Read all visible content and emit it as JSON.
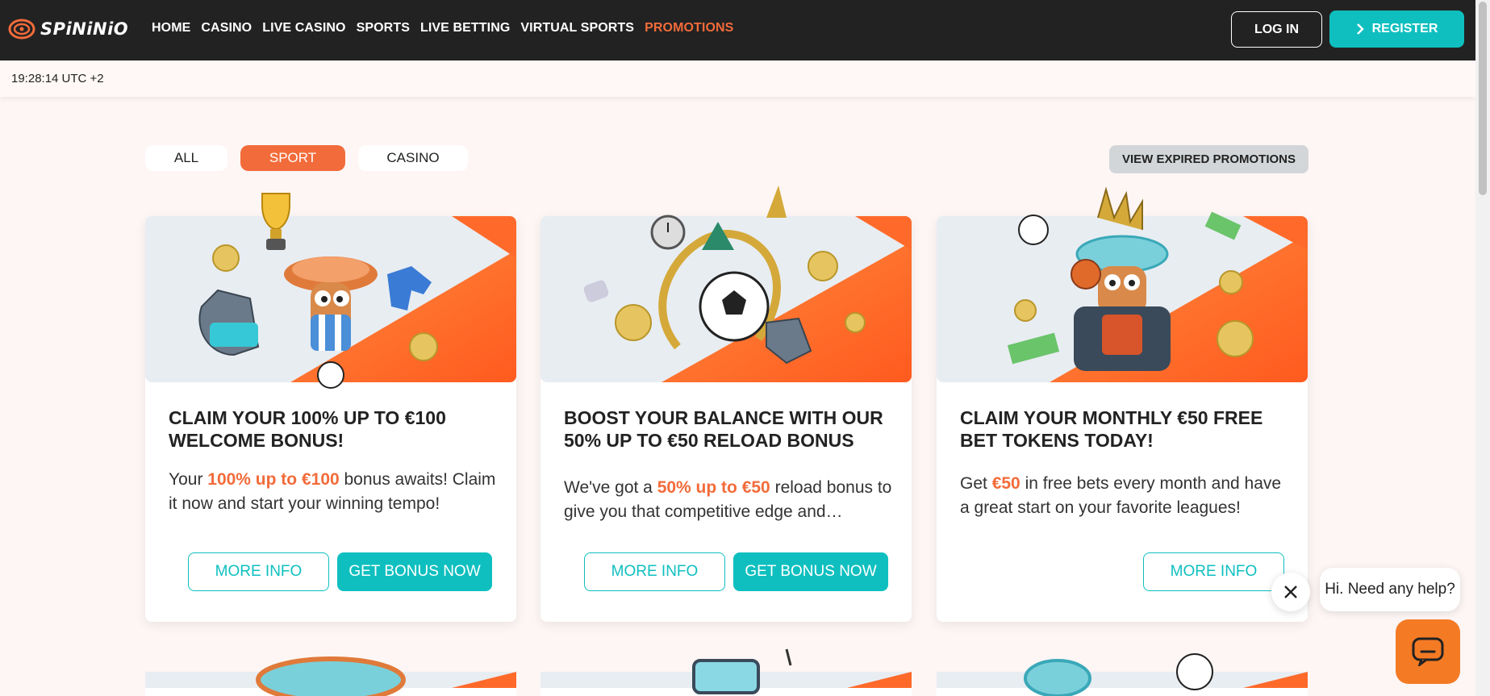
{
  "header": {
    "logo_text": "SPiNiNiO",
    "nav": [
      {
        "label": "HOME",
        "active": false
      },
      {
        "label": "CASINO",
        "active": false
      },
      {
        "label": "LIVE CASINO",
        "active": false
      },
      {
        "label": "SPORTS",
        "active": false
      },
      {
        "label": "LIVE BETTING",
        "active": false
      },
      {
        "label": "VIRTUAL SPORTS",
        "active": false
      },
      {
        "label": "PROMOTIONS",
        "active": true
      }
    ],
    "login_label": "LOG IN",
    "register_label": "REGISTER"
  },
  "timebar": {
    "time": "19:28:14 UTC +2"
  },
  "filters": {
    "tabs": [
      {
        "label": "ALL",
        "selected": false
      },
      {
        "label": "SPORT",
        "selected": true
      },
      {
        "label": "CASINO",
        "selected": false
      }
    ],
    "expired_label": "VIEW EXPIRED PROMOTIONS"
  },
  "promotions": [
    {
      "title": "CLAIM YOUR 100% UP TO €100 WELCOME BONUS!",
      "desc_before": "Your ",
      "desc_highlight": "100% up to €100",
      "desc_after": " bonus awaits! Claim it now and start your winning tempo!",
      "more_info_label": "MORE INFO",
      "bonus_label": "GET BONUS NOW"
    },
    {
      "title": "BOOST YOUR BALANCE WITH OUR 50% UP TO €50 RELOAD BONUS",
      "desc_before": "We've got a ",
      "desc_highlight": "50% up to €50",
      "desc_after": " reload bonus to give you that competitive edge and ensure…",
      "more_info_label": "MORE INFO",
      "bonus_label": "GET BONUS NOW"
    },
    {
      "title": "CLAIM YOUR MONTHLY €50 FREE BET TOKENS TODAY!",
      "desc_before": "Get ",
      "desc_highlight": "€50",
      "desc_after": " in free bets every month and have a great start on your favorite leagues!",
      "more_info_label": "MORE INFO"
    }
  ],
  "chat": {
    "greeting": "Hi. Need any help?",
    "close_icon": "close-icon",
    "launcher_icon": "chat-icon"
  },
  "colors": {
    "accent": "#f26b3a",
    "teal": "#0fbfbf",
    "header_bg": "#222222",
    "chat_orange": "#f47a24"
  }
}
